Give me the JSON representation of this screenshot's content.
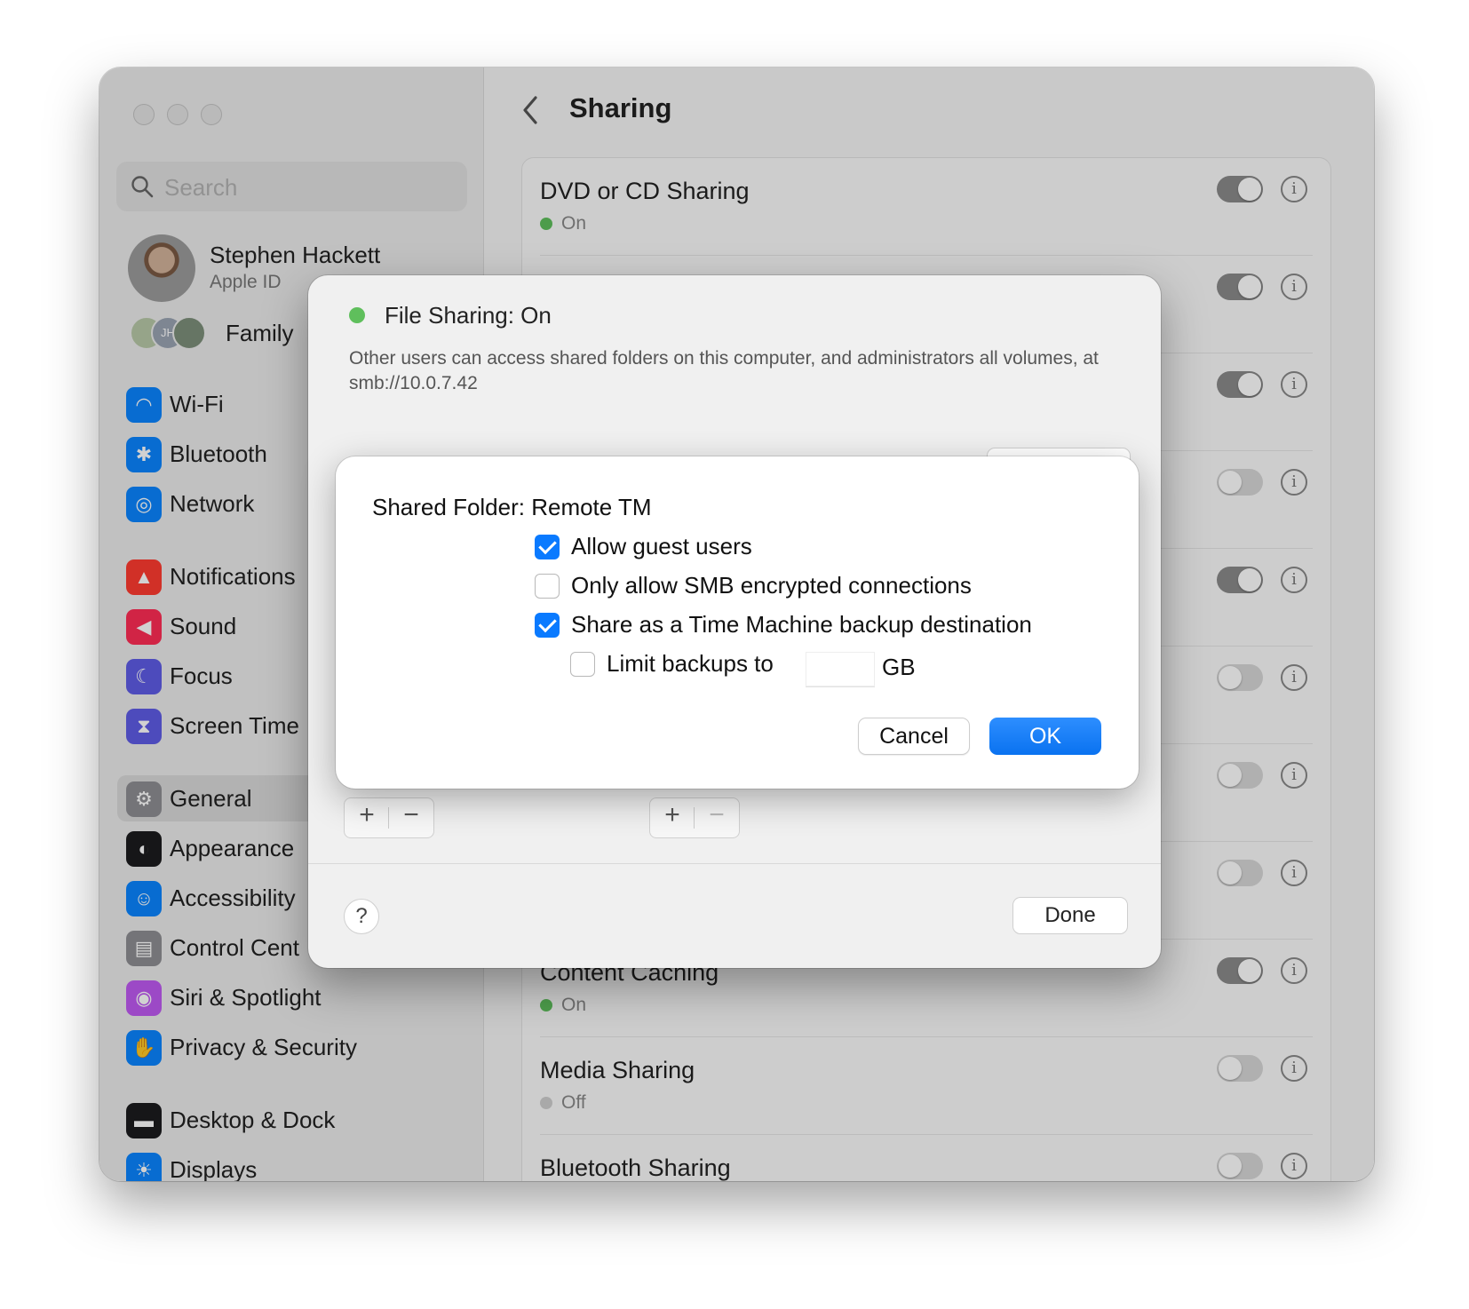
{
  "sidebar": {
    "search_placeholder": "Search",
    "profile": {
      "name": "Stephen Hackett",
      "subtitle": "Apple ID"
    },
    "family": {
      "label": "Family",
      "member_initials": "JH"
    },
    "items": [
      {
        "label": "Wi-Fi",
        "icon": "wifi-icon",
        "color": "#0a84ff"
      },
      {
        "label": "Bluetooth",
        "icon": "bluetooth-icon",
        "color": "#0a84ff"
      },
      {
        "label": "Network",
        "icon": "globe-icon",
        "color": "#0a84ff"
      },
      {
        "label": "Notifications",
        "icon": "bell-icon",
        "color": "#ff3b30"
      },
      {
        "label": "Sound",
        "icon": "speaker-icon",
        "color": "#ff2d55"
      },
      {
        "label": "Focus",
        "icon": "moon-icon",
        "color": "#5e5ce6"
      },
      {
        "label": "Screen Time",
        "icon": "hourglass-icon",
        "color": "#5e5ce6"
      },
      {
        "label": "General",
        "icon": "gear-icon",
        "color": "#8e8e93",
        "selected": true
      },
      {
        "label": "Appearance",
        "icon": "appearance-icon",
        "color": "#1c1c1e"
      },
      {
        "label": "Accessibility",
        "icon": "accessibility-icon",
        "color": "#0a84ff"
      },
      {
        "label": "Control Cent",
        "icon": "control-center-icon",
        "color": "#8e8e93"
      },
      {
        "label": "Siri & Spotlight",
        "icon": "siri-icon",
        "color": "#bf5af2"
      },
      {
        "label": "Privacy & Security",
        "icon": "hand-icon",
        "color": "#0a84ff"
      },
      {
        "label": "Desktop & Dock",
        "icon": "dock-icon",
        "color": "#1c1c1e"
      },
      {
        "label": "Displays",
        "icon": "sun-icon",
        "color": "#0a84ff"
      }
    ]
  },
  "content": {
    "title": "Sharing",
    "rows": [
      {
        "title": "DVD or CD Sharing",
        "status": "On",
        "on": true
      },
      {
        "title": "",
        "status": "",
        "on": true
      },
      {
        "title": "",
        "status": "",
        "on": true
      },
      {
        "title": "",
        "status": "",
        "on": false
      },
      {
        "title": "",
        "status": "",
        "on": true
      },
      {
        "title": "",
        "status": "",
        "on": false
      },
      {
        "title": "",
        "status": "",
        "on": false
      },
      {
        "title": "",
        "status": "",
        "on": false
      },
      {
        "title": "Content Caching",
        "status": "On",
        "on": true
      },
      {
        "title": "Media Sharing",
        "status": "Off",
        "on": false
      },
      {
        "title": "Bluetooth Sharing",
        "status": "",
        "on": false
      }
    ],
    "info_glyph": "i"
  },
  "sheet": {
    "status_title": "File Sharing: On",
    "description": "Other users can access shared folders on this computer, and administrators all volumes, at smb://10.0.7.42",
    "add_glyph": "+",
    "remove_glyph": "−",
    "help_glyph": "?",
    "done_label": "Done"
  },
  "dialog": {
    "title": "Shared Folder: Remote TM",
    "options": [
      {
        "label": "Allow guest users",
        "checked": true
      },
      {
        "label": "Only allow SMB encrypted connections",
        "checked": false
      },
      {
        "label": "Share as a Time Machine backup destination",
        "checked": true
      },
      {
        "label": "Limit backups to",
        "checked": false
      }
    ],
    "limit_value": "",
    "limit_unit": "GB",
    "cancel_label": "Cancel",
    "ok_label": "OK"
  },
  "colors": {
    "accent": "#0a7aff",
    "status_on": "#5fbf5c",
    "status_off": "#cfcfcf"
  }
}
